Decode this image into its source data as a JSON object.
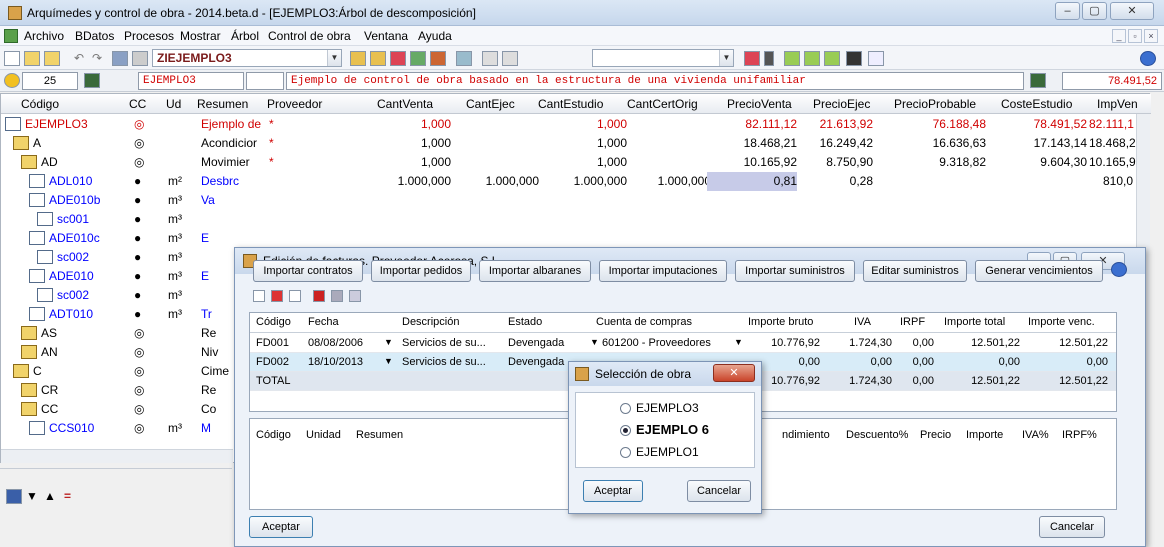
{
  "window": {
    "title": "Arquímedes y control de obra - 2014.beta.d - [EJEMPLO3:Árbol de descomposición]"
  },
  "menu": [
    "Archivo",
    "BDatos",
    "Procesos",
    "Mostrar",
    "Árbol",
    "Control de obra",
    "Ventana",
    "Ayuda"
  ],
  "toolbar": {
    "project_combo": "ZIEJEMPLO3"
  },
  "infobar": {
    "level": "25",
    "code": "EJEMPLO3",
    "description": "Ejemplo de control de obra basado en la estructura de una vivienda unifamiliar",
    "total": "78.491,52"
  },
  "grid": {
    "headers": [
      "Código",
      "CC",
      "Ud",
      "Resumen",
      "Proveedor",
      "CantVenta",
      "CantEjec",
      "CantEstudio",
      "CantCertOrig",
      "PrecioVenta",
      "PrecioEjec",
      "PrecioProbable",
      "CosteEstudio",
      "ImpVen"
    ],
    "rows": [
      {
        "code": "EJEMPLO3",
        "ud": "",
        "resumen": "Ejemplo de",
        "prov": "*",
        "cv": "1,000",
        "ce": "",
        "cest": "1,000",
        "cco": "",
        "pv": "82.111,12",
        "pe": "21.613,92",
        "pp": "76.188,48",
        "cost": "78.491,52",
        "iv": "82.111,1"
      },
      {
        "code": "A",
        "ud": "",
        "resumen": "Acondicior",
        "prov": "*",
        "cv": "1,000",
        "ce": "",
        "cest": "1,000",
        "cco": "",
        "pv": "18.468,21",
        "pe": "16.249,42",
        "pp": "16.636,63",
        "cost": "17.143,14",
        "iv": "18.468,2"
      },
      {
        "code": "AD",
        "ud": "",
        "resumen": "Movimier",
        "prov": "*",
        "cv": "1,000",
        "ce": "",
        "cest": "1,000",
        "cco": "",
        "pv": "10.165,92",
        "pe": "8.750,90",
        "pp": "9.318,82",
        "cost": "9.604,30",
        "iv": "10.165,9"
      },
      {
        "code": "ADL010",
        "ud": "m²",
        "resumen": "Desbrc",
        "prov": "",
        "cv": "1.000,000",
        "ce": "1.000,000",
        "cest": "1.000,000",
        "cco": "1.000,000",
        "pv": "0,81",
        "pe": "0,28",
        "pp": "",
        "cost": "",
        "iv": "810,0"
      },
      {
        "code": "ADE010b",
        "ud": "m³",
        "resumen": "Va",
        "prov": "",
        "cv": "",
        "ce": "",
        "cest": "",
        "cco": "",
        "pv": "",
        "pe": "",
        "pp": "",
        "cost": "",
        "iv": ""
      },
      {
        "code": "sc001",
        "ud": "m³",
        "resumen": "",
        "prov": "",
        "cv": "",
        "ce": "",
        "cest": "",
        "cco": "",
        "pv": "",
        "pe": "",
        "pp": "",
        "cost": "",
        "iv": ""
      },
      {
        "code": "ADE010c",
        "ud": "m³",
        "resumen": "E",
        "prov": "",
        "cv": "",
        "ce": "",
        "cest": "",
        "cco": "",
        "pv": "",
        "pe": "",
        "pp": "",
        "cost": "",
        "iv": ""
      },
      {
        "code": "sc002",
        "ud": "m³",
        "resumen": "",
        "prov": "",
        "cv": "",
        "ce": "",
        "cest": "",
        "cco": "",
        "pv": "",
        "pe": "",
        "pp": "",
        "cost": "",
        "iv": ""
      },
      {
        "code": "ADE010",
        "ud": "m³",
        "resumen": "E",
        "prov": "",
        "cv": "",
        "ce": "",
        "cest": "",
        "cco": "",
        "pv": "",
        "pe": "",
        "pp": "",
        "cost": "",
        "iv": ""
      },
      {
        "code": "sc002",
        "ud": "m³",
        "resumen": "",
        "prov": "",
        "cv": "",
        "ce": "",
        "cest": "",
        "cco": "",
        "pv": "",
        "pe": "",
        "pp": "",
        "cost": "",
        "iv": ""
      },
      {
        "code": "ADT010",
        "ud": "m³",
        "resumen": "Tr",
        "prov": "",
        "cv": "",
        "ce": "",
        "cest": "",
        "cco": "",
        "pv": "",
        "pe": "",
        "pp": "",
        "cost": "",
        "iv": ""
      },
      {
        "code": "AS",
        "ud": "",
        "resumen": "Re",
        "prov": "",
        "cv": "",
        "ce": "",
        "cest": "",
        "cco": "",
        "pv": "",
        "pe": "",
        "pp": "",
        "cost": "",
        "iv": ""
      },
      {
        "code": "AN",
        "ud": "",
        "resumen": "Niv",
        "prov": "",
        "cv": "",
        "ce": "",
        "cest": "",
        "cco": "",
        "pv": "",
        "pe": "",
        "pp": "",
        "cost": "",
        "iv": ""
      },
      {
        "code": "C",
        "ud": "",
        "resumen": "Cime",
        "prov": "",
        "cv": "",
        "ce": "",
        "cest": "",
        "cco": "",
        "pv": "",
        "pe": "",
        "pp": "",
        "cost": "",
        "iv": ""
      },
      {
        "code": "CR",
        "ud": "",
        "resumen": "Re",
        "prov": "",
        "cv": "",
        "ce": "",
        "cest": "",
        "cco": "",
        "pv": "",
        "pe": "",
        "pp": "",
        "cost": "",
        "iv": ""
      },
      {
        "code": "CC",
        "ud": "",
        "resumen": "Co",
        "prov": "",
        "cv": "",
        "ce": "",
        "cest": "",
        "cco": "",
        "pv": "",
        "pe": "",
        "pp": "",
        "cost": "",
        "iv": ""
      },
      {
        "code": "CCS010",
        "ud": "m³",
        "resumen": "M",
        "prov": "",
        "cv": "",
        "ce": "",
        "cest": "",
        "cco": "",
        "pv": "",
        "pe": "",
        "pp": "",
        "cost": "",
        "iv": ""
      }
    ]
  },
  "invoice_dialog": {
    "title": "Edición de facturas. Proveedor Acerosa, S.L.",
    "buttons": [
      "Importar contratos",
      "Importar pedidos",
      "Importar albaranes",
      "Importar imputaciones",
      "Importar suministros",
      "Editar suministros",
      "Generar vencimientos"
    ],
    "headers": [
      "Código",
      "Fecha",
      "Descripción",
      "Estado",
      "Cuenta de compras",
      "Importe bruto",
      "IVA",
      "IRPF",
      "Importe total",
      "Importe venc."
    ],
    "rows": [
      {
        "code": "FD001",
        "date": "08/08/2006",
        "desc": "Servicios de su...",
        "state": "Devengada",
        "account": "601200 - Proveedores",
        "gross": "10.776,92",
        "iva": "1.724,30",
        "irpf": "0,00",
        "total": "12.501,22",
        "venc": "12.501,22"
      },
      {
        "code": "FD002",
        "date": "18/10/2013",
        "desc": "Servicios de su...",
        "state": "Devengada",
        "account": "",
        "gross": "0,00",
        "iva": "0,00",
        "irpf": "0,00",
        "total": "0,00",
        "venc": "0,00"
      },
      {
        "code": "TOTAL",
        "date": "",
        "desc": "",
        "state": "",
        "account": "",
        "gross": "10.776,92",
        "iva": "1.724,30",
        "irpf": "0,00",
        "total": "12.501,22",
        "venc": "12.501,22"
      }
    ],
    "lower_headers": [
      "Código",
      "Unidad",
      "Resumen",
      "ndimiento",
      "Descuento%",
      "Precio",
      "Importe",
      "IVA%",
      "IRPF%"
    ],
    "accept": "Aceptar",
    "cancel": "Cancelar"
  },
  "select_dialog": {
    "title": "Selección de obra",
    "options": [
      "EJEMPLO3",
      "EJEMPLO 6",
      "EJEMPLO1"
    ],
    "selected": "EJEMPLO 6",
    "accept": "Aceptar",
    "cancel": "Cancelar"
  },
  "colors": {
    "accent": "#d00000",
    "selected_row": "#d8ecf8",
    "highlight_cell": "#c7cbe8"
  }
}
